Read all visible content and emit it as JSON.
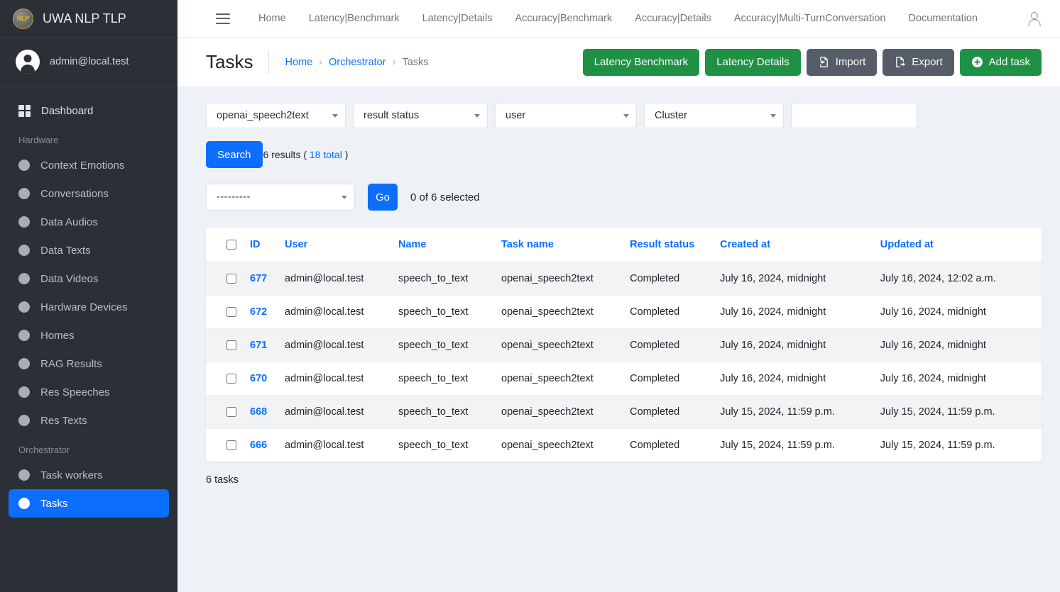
{
  "brand": {
    "logo_text": "NLP",
    "title": "UWA NLP TLP",
    "logo_icon": "nlp-coin-logo"
  },
  "user": {
    "email": "admin@local.test",
    "avatar_icon": "user-avatar-icon"
  },
  "sidebar": {
    "dashboard": {
      "label": "Dashboard",
      "icon": "grid-icon"
    },
    "sections": [
      {
        "title": "Hardware",
        "items": [
          {
            "label": "Context Emotions"
          },
          {
            "label": "Conversations"
          },
          {
            "label": "Data Audios"
          },
          {
            "label": "Data Texts"
          },
          {
            "label": "Data Videos"
          },
          {
            "label": "Hardware Devices"
          },
          {
            "label": "Homes"
          },
          {
            "label": "RAG Results"
          },
          {
            "label": "Res Speeches"
          },
          {
            "label": "Res Texts"
          }
        ]
      },
      {
        "title": "Orchestrator",
        "items": [
          {
            "label": "Task workers"
          },
          {
            "label": "Tasks",
            "active": true
          }
        ]
      }
    ]
  },
  "topnav": {
    "menu_icon": "hamburger-icon",
    "account_icon": "user-account-icon",
    "items": [
      {
        "label": "Home"
      },
      {
        "label": "Latency|Benchmark"
      },
      {
        "label": "Latency|Details"
      },
      {
        "label": "Accuracy|Benchmark"
      },
      {
        "label": "Accuracy|Details"
      },
      {
        "label": "Accuracy|Multi-TurnConversation"
      },
      {
        "label": "Documentation"
      }
    ]
  },
  "page": {
    "title": "Tasks",
    "breadcrumb": [
      {
        "label": "Home",
        "link": true
      },
      {
        "label": "Orchestrator",
        "link": true
      },
      {
        "label": "Tasks",
        "link": false
      }
    ],
    "separator": "›",
    "actions": [
      {
        "label": "Latency Benchmark",
        "style": "green",
        "icon": null
      },
      {
        "label": "Latency Details",
        "style": "green",
        "icon": null
      },
      {
        "label": "Import",
        "style": "gray",
        "icon": "import-file-icon"
      },
      {
        "label": "Export",
        "style": "gray",
        "icon": "export-file-icon"
      },
      {
        "label": "Add task",
        "style": "green",
        "icon": "plus-circle-icon"
      }
    ]
  },
  "filters": {
    "task_name": {
      "value": "openai_speech2text",
      "icon": "chevron-down-icon"
    },
    "result_status": {
      "value": "result status",
      "icon": "chevron-down-icon"
    },
    "user": {
      "value": "user",
      "icon": "chevron-down-icon"
    },
    "cluster": {
      "value": "Cluster",
      "icon": "chevron-down-icon"
    },
    "search_text": {
      "value": "",
      "placeholder": ""
    },
    "search_button": "Search",
    "results_prefix": "6 results ( ",
    "results_total": "18 total",
    "results_suffix": " )"
  },
  "bulk_action": {
    "select_value": "---------",
    "go_button": "Go",
    "selected_text": "0 of 6 selected"
  },
  "table": {
    "columns": [
      {
        "key": "id",
        "label": "ID"
      },
      {
        "key": "user",
        "label": "User"
      },
      {
        "key": "name",
        "label": "Name"
      },
      {
        "key": "task_name",
        "label": "Task name"
      },
      {
        "key": "result_status",
        "label": "Result status"
      },
      {
        "key": "created_at",
        "label": "Created at"
      },
      {
        "key": "updated_at",
        "label": "Updated at"
      }
    ],
    "rows": [
      {
        "id": "677",
        "user": "admin@local.test",
        "name": "speech_to_text",
        "task_name": "openai_speech2text",
        "result_status": "Completed",
        "created_at": "July 16, 2024, midnight",
        "updated_at": "July 16, 2024, 12:02 a.m."
      },
      {
        "id": "672",
        "user": "admin@local.test",
        "name": "speech_to_text",
        "task_name": "openai_speech2text",
        "result_status": "Completed",
        "created_at": "July 16, 2024, midnight",
        "updated_at": "July 16, 2024, midnight"
      },
      {
        "id": "671",
        "user": "admin@local.test",
        "name": "speech_to_text",
        "task_name": "openai_speech2text",
        "result_status": "Completed",
        "created_at": "July 16, 2024, midnight",
        "updated_at": "July 16, 2024, midnight"
      },
      {
        "id": "670",
        "user": "admin@local.test",
        "name": "speech_to_text",
        "task_name": "openai_speech2text",
        "result_status": "Completed",
        "created_at": "July 16, 2024, midnight",
        "updated_at": "July 16, 2024, midnight"
      },
      {
        "id": "668",
        "user": "admin@local.test",
        "name": "speech_to_text",
        "task_name": "openai_speech2text",
        "result_status": "Completed",
        "created_at": "July 15, 2024, 11:59 p.m.",
        "updated_at": "July 15, 2024, 11:59 p.m."
      },
      {
        "id": "666",
        "user": "admin@local.test",
        "name": "speech_to_text",
        "task_name": "openai_speech2text",
        "result_status": "Completed",
        "created_at": "July 15, 2024, 11:59 p.m.",
        "updated_at": "July 15, 2024, 11:59 p.m."
      }
    ],
    "footer": "6 tasks"
  },
  "colors": {
    "accent_blue": "#0d6efd",
    "green": "#1f9145",
    "gray_button": "#555e68",
    "sidebar_bg": "#2b2f36",
    "page_bg": "#eef1f5"
  }
}
